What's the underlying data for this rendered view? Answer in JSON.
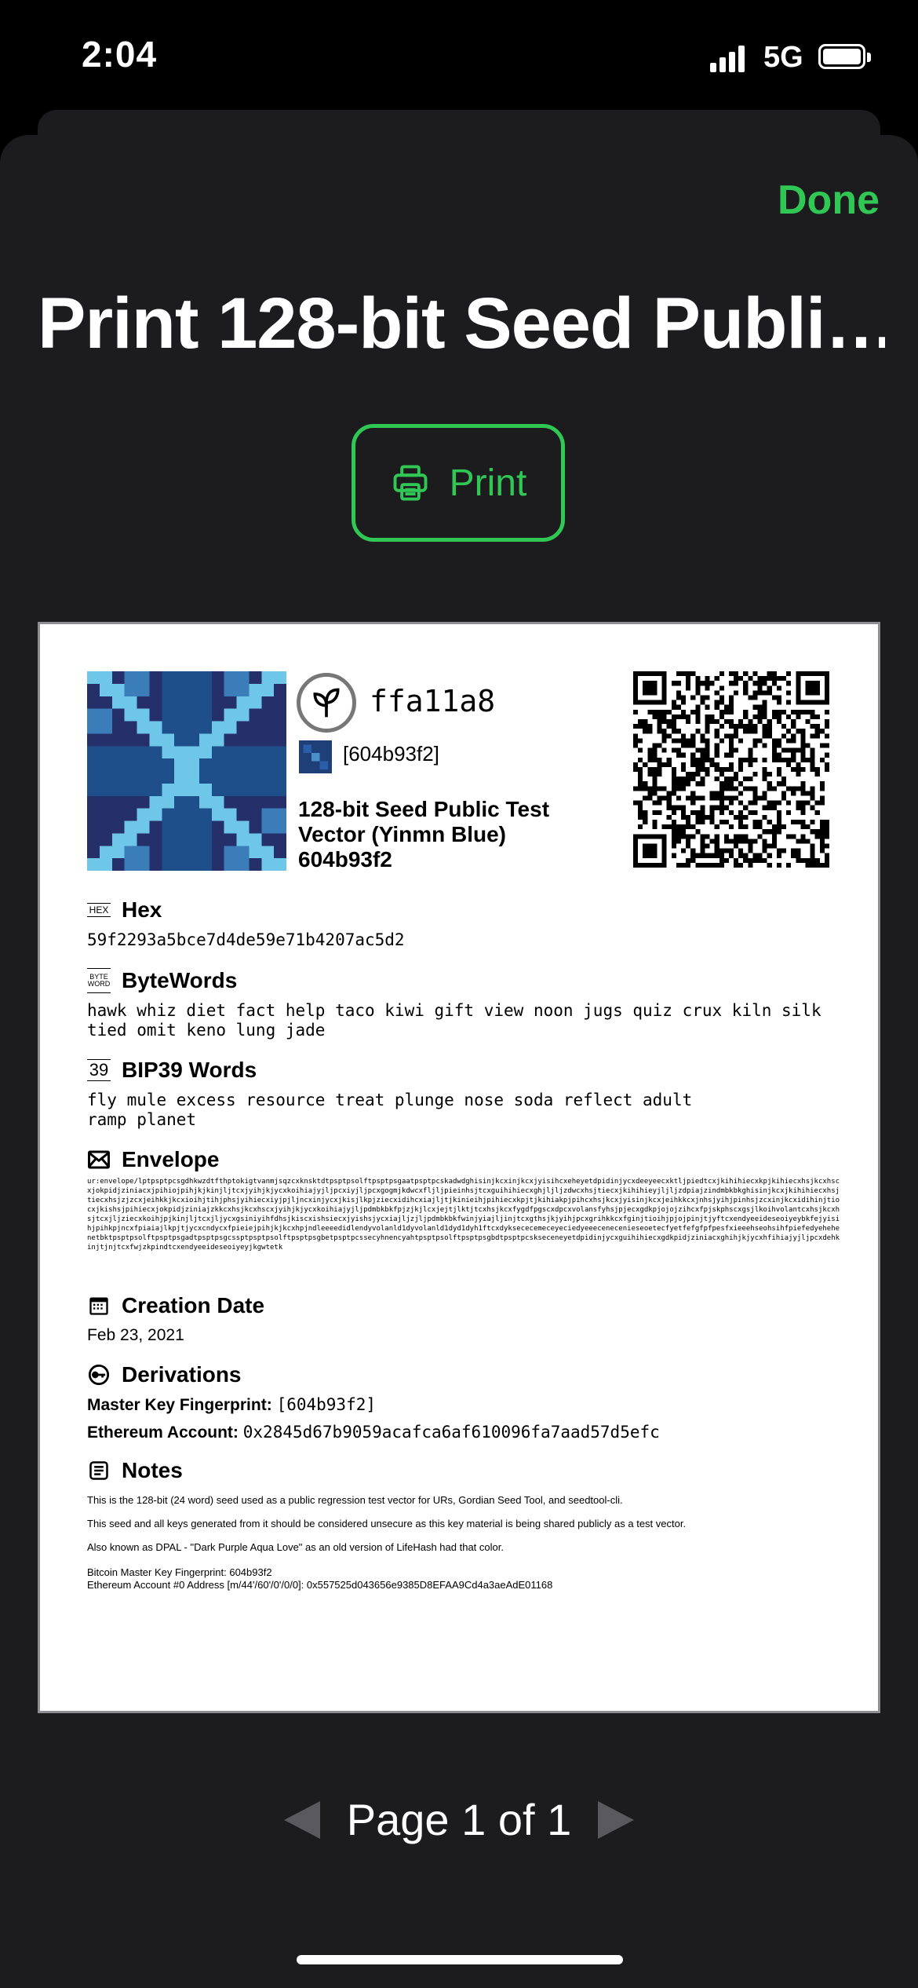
{
  "status": {
    "time": "2:04",
    "network": "5G"
  },
  "header": {
    "done_label": "Done",
    "title": "Print 128-bit Seed Publi…",
    "print_label": "Print"
  },
  "card": {
    "identifier": "ffa11a8",
    "fingerprint": "[604b93f2]",
    "seed_name": "128-bit Seed Public Test Vector (Yinmn Blue) 604b93f2",
    "hex": {
      "label": "Hex",
      "value": "59f2293a5bce7d4de59e71b4207ac5d2"
    },
    "bytewords": {
      "label": "ByteWords",
      "value": "hawk whiz diet fact help taco kiwi gift view noon jugs quiz crux kiln silk tied omit keno lung jade"
    },
    "bip39": {
      "label": "BIP39 Words",
      "value": "fly mule excess resource treat plunge nose soda reflect adult ramp planet"
    },
    "envelope": {
      "label": "Envelope",
      "value": "ur:envelope/lptpsptpcsgdhkwzdtfthptokigtvanmjsqzcxknsktdtpsptpsolftpsptpsgaatpsptpcskadwdghisinjkcxinjkcxjyisihcxeheyetdpidinjycxdeeyeecxktljpiedtcxjkihihiecxkpjkihiecxhsjkcxhscxjokpidjziniacxjpihiojpihjkjkinjljtcxjyihjkjycxkoihiajyjljpcxiyjljpcxgogmjkdwcxfljljpieinhsjtcxguihihiecxghjljljzdwcxhsjtiecxjkihihieyjljljzdpiajzindmbkbkghisinjkcxjkihihiecxhsjtiecxhsjzjzcxjeihkkjkcxioihjtihjphsjyihiecxiyjpjljncxinjycxjkisjlkpjziecxidihcxiajljtjkinieihjpihiecxkpjtjkihiakpjpihcxhsjkcxjyisinjkcxjeihkkcxjnhsjyihjpinhsjzcxinjkcxidihinjtiocxjkishsjpihiecxjokpidjziniajzkkcxhsjkcxhscxjyihjkjycxkoihiajyjljpdmbkbkfpjzjkjlcxjejtjlktjtcxhsjkcxfygdfpgscxdpcxvolansfyhsjpjecxgdkpjojojzihcxfpjskphscxgsjlkoihvolantcxhsjkcxhsjtcxjljziecxkoihjpjkinjljtcxjljycxgsiniyihfdhsjkiscxishsiecxjyishsjycxiajljzjljpdmbkbkfwinjyiajljinjtcxgthsjkjyihjpcxgrihkkcxfginjtioihjpjojpinjtjyftcxendyeeideseoiyeybkfejyisihjpihkpjncxfpiaiajlkpjtjycxcndycxfpieiejpihjkjkcxhpjndleeeedidlendyvolanld1dyvolanld1dyd1dyh1ftcxdyksececemeceyeciedyeeecenecenieseoetecfyetfefgfpfpesfxieeehseohsihfpiefedyehehenetbktpsptpsolftpsptpsgadtpsptpsgcssptpsptpsolftpsptpsgbetpsptpcssecyhnencyahtpsptpsolftpsptpsgbdtpsptpcskseceneyetdpidinjycxguihihiecxgdkpidjziniacxghihjkjycxhfihiajyjljpcxdehkinjtjnjtcxfwjzkpindtcxendyeeideseoiyeyjkgwtetk"
    },
    "creation": {
      "label": "Creation Date",
      "value": "Feb 23, 2021"
    },
    "derivations": {
      "label": "Derivations",
      "master_key_label": "Master Key Fingerprint:",
      "master_key_value": "[604b93f2]",
      "eth_label": "Ethereum Account:",
      "eth_value": "0x2845d67b9059acafca6af610096fa7aad57d5efc"
    },
    "notes": {
      "label": "Notes",
      "line1": "This is the 128-bit (24 word) seed used as a public regression test vector for URs, Gordian Seed Tool, and seedtool-cli.",
      "line2": "This seed and all keys generated from it should be considered unsecure as this key material is being shared publicly as a test vector.",
      "line3": "Also known as DPAL - \"Dark Purple Aqua Love\" as an old version of LifeHash had that color.",
      "line4": "Bitcoin Master Key Fingerprint: 604b93f2",
      "line5": "Ethereum Account #0 Address [m/44'/60'/0'/0/0]: 0x557525d043656e9385D8EFAA9Cd4a3aeAdE01168"
    }
  },
  "pager": {
    "label": "Page 1 of 1"
  },
  "colors": {
    "accent": "#30c755",
    "sheet": "#1c1c1e"
  }
}
